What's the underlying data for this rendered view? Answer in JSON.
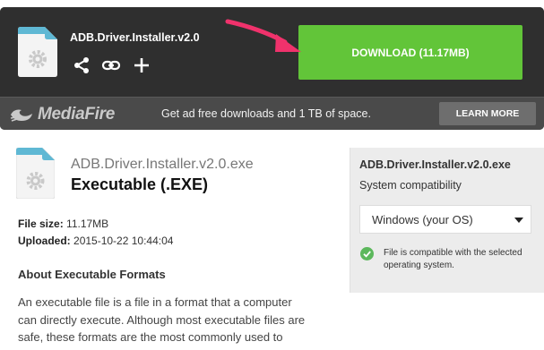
{
  "card": {
    "filename": "ADB.Driver.Installer.v2.0",
    "download_label": "DOWNLOAD (11.17MB)",
    "icons": [
      "share-icon",
      "link-icon",
      "add-icon"
    ]
  },
  "banner": {
    "logo": "MediaFire",
    "promo": "Get ad free downloads and 1 TB of space.",
    "learn_more": "LEARN MORE"
  },
  "file": {
    "title": "ADB.Driver.Installer.v2.0.exe",
    "type": "Executable (.EXE)",
    "size_label": "File size:",
    "size_value": "11.17MB",
    "uploaded_label": "Uploaded:",
    "uploaded_value": "2015-10-22 10:44:04",
    "about_heading": "About Executable Formats",
    "about_body": "An executable file is a file in a format that a computer can directly execute. Although most executable files are safe, these formats are the most commonly used to transmit viruses and infect computers with malware."
  },
  "compat": {
    "file": "ADB.Driver.Installer.v2.0.exe",
    "label": "System compatibility",
    "os": "Windows (your OS)",
    "message": "File is compatible with the selected operating system."
  },
  "colors": {
    "download_green": "#62c539",
    "dark_bg": "#2f2f2f",
    "banner_bg": "#4a4a4a",
    "arrow_pink": "#f0326c",
    "file_icon_blue": "#5fb8d4",
    "check_green": "#5cb85c"
  }
}
